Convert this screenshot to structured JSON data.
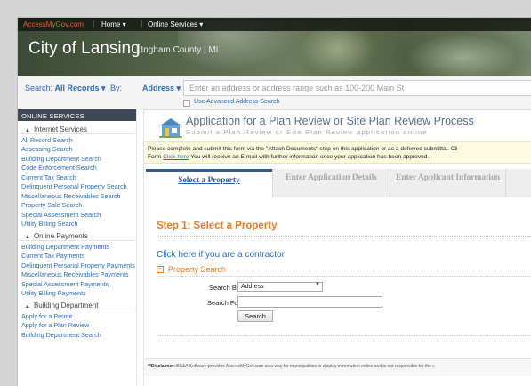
{
  "topnav": {
    "brand": "AccessMyGov.com",
    "home": "Home ▾",
    "online_services": "Online Services ▾"
  },
  "header": {
    "city": "City of Lansing",
    "county": "| Ingham County | MI"
  },
  "searchbar": {
    "search_label": "Search:",
    "search_value": "All Records ▾",
    "by_label": "By:",
    "by_value": "Address ▾",
    "placeholder": "Enter an address or address range such as 100-200 Main St",
    "advanced_label": "Use Advanced Address Search"
  },
  "sidebar": {
    "heading": "ONLINE SERVICES",
    "groups": [
      {
        "title": "Internet Services",
        "items": [
          "All Record Search",
          "Assessing Search",
          "Building Department Search",
          "Code Enforcement Search",
          "Current Tax Search",
          "Delinquent Personal Property Search",
          "Miscellaneous Receivables Search",
          "Property Sale Search",
          "Special Assessment Search",
          "Utility Billing Search"
        ]
      },
      {
        "title": "Online Payments",
        "items": [
          "Building Department Payments",
          "Current Tax Payments",
          "Delinquent Personal Property Payments",
          "Miscellaneous Receivables Payments",
          "Special Assessment Payments",
          "Utility Billing Payments"
        ]
      },
      {
        "title": "Building Department",
        "items": [
          "Apply for a Permit",
          "Apply for a Plan Review",
          "Building Department Search"
        ]
      }
    ]
  },
  "main": {
    "title": "Application for a Plan Review or Site Plan Review Process",
    "subtitle": "Submit a Plan Review or Site Plan Review application online",
    "note_line1": "Please complete and submit this form via the \"Attach Documents\" step on this application or as a deferred submittal. Cli",
    "note_line2_pre": "Form ",
    "note_link": "Click here",
    "note_line2_post": " You will receive an E-mail with further information once your application has been approved.",
    "tabs": [
      "Select a Property",
      "Enter Application Details",
      "Enter Applicant Information"
    ],
    "step_heading": "Step 1: Select a Property",
    "contractor_link": "Click here if you are a contractor",
    "property_search_label": "Property Search",
    "collapse_symbol": "−",
    "search_by_label": "Search By:",
    "search_by_value": "Address",
    "search_for_label": "Search For:",
    "search_button": "Search",
    "disclaimer_bold": "**Disclaimer:",
    "disclaimer_text": " BS&A Software provides AccessMyGov.com as a way for municipalities to display information online and is not responsible for the c"
  },
  "colors": {
    "accent_orange": "#f0791c",
    "link_blue": "#2a6ebb",
    "sidebar_header": "#3e4956",
    "note_bg": "#fdfbe0"
  }
}
